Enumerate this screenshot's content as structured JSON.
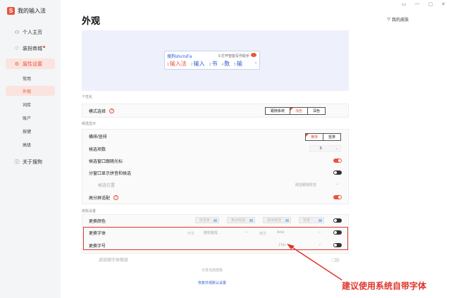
{
  "app": {
    "logo_glyph": "S",
    "title": "我的输入法"
  },
  "topbar": {
    "icons": [
      "▭",
      "—",
      "▢",
      "✕"
    ]
  },
  "sidebar": {
    "items": [
      {
        "label": "个人主页",
        "icon": "user-icon",
        "glyph": "⚇"
      },
      {
        "label": "装扮商城",
        "icon": "shirt-icon",
        "glyph": "♡"
      },
      {
        "label": "属性设置",
        "icon": "settings-icon",
        "glyph": "⚙"
      }
    ],
    "subitems": [
      {
        "label": "常用"
      },
      {
        "label": "外观"
      },
      {
        "label": "词库"
      },
      {
        "label": "账户"
      },
      {
        "label": "按键"
      },
      {
        "label": "高级"
      }
    ],
    "about": {
      "label": "关于搜狗",
      "glyph": "ⓘ"
    }
  },
  "page": {
    "title": "外观",
    "my_skin": "我的皮肤"
  },
  "preview": {
    "pinyin": "搜狗shu'ruFa",
    "tip": "9 打开智能写作助手",
    "candidates": [
      {
        "n": "1",
        "text": "输入法"
      },
      {
        "n": "2",
        "text": "输入"
      },
      {
        "n": "3",
        "text": "书"
      },
      {
        "n": "4",
        "text": "数"
      },
      {
        "n": "5",
        "text": "输"
      }
    ],
    "arrow": "›"
  },
  "personalize": {
    "section": "个性化",
    "mode_label": "模式选择",
    "help": "?",
    "modes": [
      "跟随系统",
      "浅色",
      "深色"
    ]
  },
  "candidates": {
    "section": "候选显示",
    "orient_label": "横排/竖排",
    "orient": [
      "横排",
      "竖排"
    ],
    "count_label": "候选项数",
    "count_value": "5",
    "follow_label": "候选窗口跟随光标",
    "split_label": "分窗口显示拼音和候选",
    "pos_label": "候选位置",
    "pos_value": "候选跟随拼音",
    "hidpi_label": "高分屏适配",
    "help": "?"
  },
  "skin": {
    "section": "皮肤设置",
    "color_label": "更换颜色",
    "color_slots": [
      "拼音条",
      "焦点候选",
      "其他候选",
      "背景"
    ],
    "font_label": "更换字体",
    "font_cn_label": "中文",
    "font_cn_value": "微软雅黑",
    "font_en_label": "英文",
    "font_en_value": "Arial",
    "size_label": "更换字号",
    "size_value": "17px",
    "scale_label": "皮肤随字体缩放",
    "share_link": "分享当前皮肤",
    "restore_link": "恢复外观默认设置"
  },
  "annotation": {
    "text": "建议使用系统自带字体"
  },
  "colors": {
    "accent": "#e8553e",
    "annotation": "#e0342b"
  }
}
